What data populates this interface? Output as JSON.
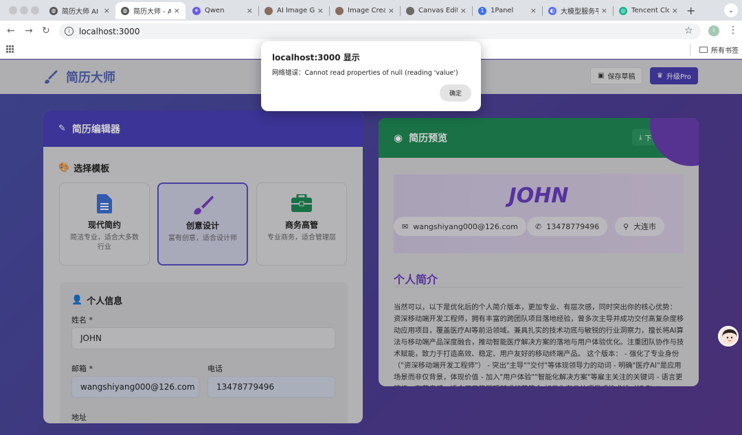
{
  "browser": {
    "tabs": [
      {
        "label": "简历大师 AI ·",
        "icon": "globe-icon"
      },
      {
        "label": "简历大师 - AI",
        "icon": "globe-icon",
        "active": true
      },
      {
        "label": "Qwen",
        "icon": "qwen-icon"
      },
      {
        "label": "AI Image Gen",
        "icon": "ai-image-icon"
      },
      {
        "label": "Image Creatio",
        "icon": "ai-image-icon"
      },
      {
        "label": "Canvas Edito",
        "icon": "canvas-icon"
      },
      {
        "label": "1Panel",
        "icon": "1panel-icon"
      },
      {
        "label": "大模型服务平",
        "icon": "llm-icon"
      },
      {
        "label": "Tencent Clou",
        "icon": "tencent-icon"
      }
    ],
    "url": "localhost:3000",
    "profile_initial": "I",
    "bookmarks_all": "所有书签"
  },
  "dialog": {
    "title": "localhost:3000 显示",
    "message": "网络错误：Cannot read properties of null (reading 'value')",
    "ok_label": "确定"
  },
  "header": {
    "brand": "简历大师",
    "save_draft": "保存草稿",
    "upgrade": "升级Pro"
  },
  "editor": {
    "title": "简历编辑器",
    "template_section": "选择模板",
    "templates": [
      {
        "name": "现代简约",
        "desc": "简洁专业，适合大多数行业",
        "icon": "document-icon",
        "color": "#3b6fd6"
      },
      {
        "name": "创意设计",
        "desc": "富有创意，适合设计师",
        "icon": "paintbrush-icon",
        "color": "#7b3fc2",
        "selected": true
      },
      {
        "name": "商务高管",
        "desc": "专业商务，适合管理层",
        "icon": "briefcase-icon",
        "color": "#1e8a55"
      }
    ],
    "personal": {
      "title": "个人信息",
      "name_label": "姓名 *",
      "name_value": "JOHN",
      "email_label": "邮箱 *",
      "email_value": "wangshiyang000@126.com",
      "phone_label": "电话",
      "phone_value": "13478779496",
      "address_label": "地址"
    }
  },
  "preview": {
    "title": "简历预览",
    "download": "下",
    "name": "JOHN",
    "email": "wangshiyang000@126.com",
    "phone": "13478779496",
    "city": "大连市",
    "section": "个人简介",
    "summary": "当然可以，以下是优化后的个人简介版本，更加专业、有层次感，同时突出你的核心优势： 资深移动端开发工程师，拥有丰富的跨团队项目落地经验，曾多次主导并成功交付高复杂度移动应用项目，覆盖医疗AI等前沿领域。兼具扎实的技术功底与敏锐的行业洞察力，擅长将AI算法与移动端产品深度融合，推动智能医疗解决方案的落地与用户体验优化。注重团队协作与技术赋能，致力于打造高效、稳定、用户友好的移动终端产品。 这个版本： - 强化了专业身份（\"资深移动端开发工程师\"） - 突出\"主导\"\"交付\"等体现领导力的动词 - 明确\"医疗AI\"是应用场景而非仅背景，体现价值 - 加入\"用户体验\"\"智能化解决方案\"等雇主关注的关键词 - 语言更精炼、有节奏感，适合用于简历顶部或领英简介 如果你有具体项目或技术栈（如 Flutter、iOS/Android"
  },
  "colors": {
    "editor_header": "#4a40b8",
    "preview_header": "#1f8a55",
    "accent_purple": "#6a3fc2",
    "pro_button": "#4a3fb0"
  }
}
